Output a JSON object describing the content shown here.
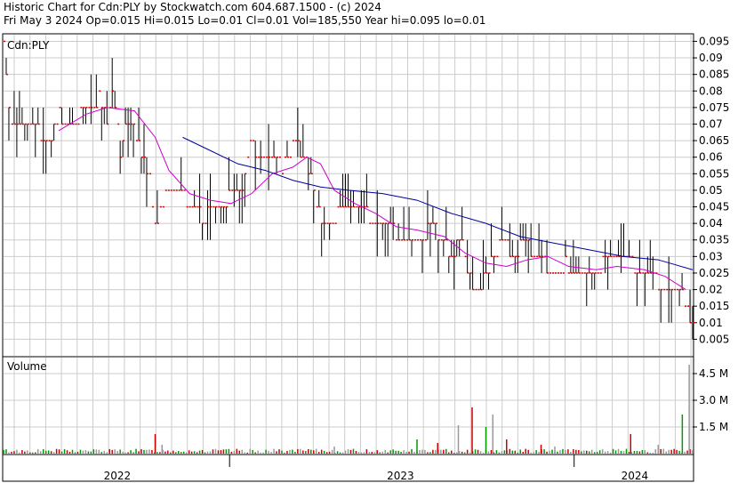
{
  "header": {
    "line1": "Historic Chart for Cdn:PLY by Stockwatch.com 604.687.1500 - (c) 2024",
    "line2": "Fri May  3 2024   Op=0.015   Hi=0.015   Lo=0.01   Cl=0.01   Vol=185,550   Year hi=0.095   lo=0.01"
  },
  "chart_data": {
    "type": "ohlc",
    "title": "Cdn:PLY",
    "price_axis": {
      "ticks": [
        "0.095",
        "0.09",
        "0.085",
        "0.08",
        "0.075",
        "0.07",
        "0.065",
        "0.06",
        "0.055",
        "0.05",
        "0.045",
        "0.04",
        "0.035",
        "0.03",
        "0.025",
        "0.02",
        "0.015",
        "0.01",
        "0.005"
      ],
      "ylim": [
        0.0,
        0.097
      ]
    },
    "volume_axis": {
      "label": "Volume",
      "ticks": [
        "4.5 M",
        "3.0 M",
        "1.5 M"
      ],
      "ylim": [
        0,
        5.4
      ]
    },
    "x_axis": {
      "labels": [
        "2022",
        "2023",
        "2024"
      ]
    },
    "series": [
      {
        "name": "price",
        "color": "#000000",
        "close_marker_color": "#cc0000"
      },
      {
        "name": "short moving average",
        "color": "#cc00cc"
      },
      {
        "name": "long moving average",
        "color": "#000099"
      }
    ],
    "price_points": [
      {
        "t": 0.0,
        "c": 0.095
      },
      {
        "t": 0.01,
        "c": 0.07
      },
      {
        "t": 0.025,
        "c": 0.068
      },
      {
        "t": 0.045,
        "c": 0.072
      },
      {
        "t": 0.06,
        "c": 0.062
      },
      {
        "t": 0.08,
        "c": 0.073
      },
      {
        "t": 0.1,
        "c": 0.07
      },
      {
        "t": 0.12,
        "c": 0.075
      },
      {
        "t": 0.14,
        "c": 0.078
      },
      {
        "t": 0.15,
        "c": 0.07
      },
      {
        "t": 0.16,
        "c": 0.08
      },
      {
        "t": 0.17,
        "c": 0.06
      },
      {
        "t": 0.18,
        "c": 0.072
      },
      {
        "t": 0.195,
        "c": 0.065
      },
      {
        "t": 0.21,
        "c": 0.055
      },
      {
        "t": 0.22,
        "c": 0.04
      },
      {
        "t": 0.235,
        "c": 0.05
      },
      {
        "t": 0.255,
        "c": 0.052
      },
      {
        "t": 0.27,
        "c": 0.045
      },
      {
        "t": 0.29,
        "c": 0.042
      },
      {
        "t": 0.31,
        "c": 0.045
      },
      {
        "t": 0.33,
        "c": 0.048
      },
      {
        "t": 0.345,
        "c": 0.05
      },
      {
        "t": 0.36,
        "c": 0.065
      },
      {
        "t": 0.375,
        "c": 0.058
      },
      {
        "t": 0.39,
        "c": 0.062
      },
      {
        "t": 0.405,
        "c": 0.056
      },
      {
        "t": 0.42,
        "c": 0.065
      },
      {
        "t": 0.435,
        "c": 0.06
      },
      {
        "t": 0.45,
        "c": 0.05
      },
      {
        "t": 0.465,
        "c": 0.04
      },
      {
        "t": 0.48,
        "c": 0.042
      },
      {
        "t": 0.5,
        "c": 0.045
      },
      {
        "t": 0.515,
        "c": 0.045
      },
      {
        "t": 0.53,
        "c": 0.042
      },
      {
        "t": 0.545,
        "c": 0.038
      },
      {
        "t": 0.56,
        "c": 0.04
      },
      {
        "t": 0.575,
        "c": 0.035
      },
      {
        "t": 0.59,
        "c": 0.033
      },
      {
        "t": 0.605,
        "c": 0.035
      },
      {
        "t": 0.62,
        "c": 0.04
      },
      {
        "t": 0.635,
        "c": 0.035
      },
      {
        "t": 0.65,
        "c": 0.03
      },
      {
        "t": 0.665,
        "c": 0.035
      },
      {
        "t": 0.68,
        "c": 0.02
      },
      {
        "t": 0.695,
        "c": 0.022
      },
      {
        "t": 0.71,
        "c": 0.03
      },
      {
        "t": 0.725,
        "c": 0.035
      },
      {
        "t": 0.74,
        "c": 0.03
      },
      {
        "t": 0.755,
        "c": 0.035
      },
      {
        "t": 0.77,
        "c": 0.03
      },
      {
        "t": 0.785,
        "c": 0.028
      },
      {
        "t": 0.8,
        "c": 0.025
      },
      {
        "t": 0.815,
        "c": 0.028
      },
      {
        "t": 0.83,
        "c": 0.025
      },
      {
        "t": 0.845,
        "c": 0.025
      },
      {
        "t": 0.86,
        "c": 0.025
      },
      {
        "t": 0.875,
        "c": 0.03
      },
      {
        "t": 0.89,
        "c": 0.028
      },
      {
        "t": 0.905,
        "c": 0.03
      },
      {
        "t": 0.92,
        "c": 0.025
      },
      {
        "t": 0.935,
        "c": 0.025
      },
      {
        "t": 0.95,
        "c": 0.022
      },
      {
        "t": 0.965,
        "c": 0.02
      },
      {
        "t": 0.98,
        "c": 0.02
      },
      {
        "t": 0.99,
        "c": 0.015
      },
      {
        "t": 1.0,
        "c": 0.01
      }
    ],
    "short_ma": [
      {
        "t": 0.08,
        "v": 0.068
      },
      {
        "t": 0.12,
        "v": 0.073
      },
      {
        "t": 0.15,
        "v": 0.075
      },
      {
        "t": 0.19,
        "v": 0.074
      },
      {
        "t": 0.22,
        "v": 0.066
      },
      {
        "t": 0.24,
        "v": 0.056
      },
      {
        "t": 0.27,
        "v": 0.049
      },
      {
        "t": 0.3,
        "v": 0.047
      },
      {
        "t": 0.33,
        "v": 0.046
      },
      {
        "t": 0.36,
        "v": 0.049
      },
      {
        "t": 0.39,
        "v": 0.055
      },
      {
        "t": 0.42,
        "v": 0.057
      },
      {
        "t": 0.44,
        "v": 0.06
      },
      {
        "t": 0.46,
        "v": 0.058
      },
      {
        "t": 0.48,
        "v": 0.05
      },
      {
        "t": 0.51,
        "v": 0.046
      },
      {
        "t": 0.54,
        "v": 0.043
      },
      {
        "t": 0.57,
        "v": 0.039
      },
      {
        "t": 0.6,
        "v": 0.038
      },
      {
        "t": 0.64,
        "v": 0.036
      },
      {
        "t": 0.67,
        "v": 0.031
      },
      {
        "t": 0.7,
        "v": 0.028
      },
      {
        "t": 0.73,
        "v": 0.027
      },
      {
        "t": 0.76,
        "v": 0.029
      },
      {
        "t": 0.79,
        "v": 0.03
      },
      {
        "t": 0.82,
        "v": 0.027
      },
      {
        "t": 0.86,
        "v": 0.026
      },
      {
        "t": 0.89,
        "v": 0.027
      },
      {
        "t": 0.93,
        "v": 0.026
      },
      {
        "t": 0.96,
        "v": 0.024
      },
      {
        "t": 0.99,
        "v": 0.02
      }
    ],
    "long_ma": [
      {
        "t": 0.26,
        "v": 0.066
      },
      {
        "t": 0.3,
        "v": 0.062
      },
      {
        "t": 0.34,
        "v": 0.058
      },
      {
        "t": 0.38,
        "v": 0.056
      },
      {
        "t": 0.42,
        "v": 0.053
      },
      {
        "t": 0.46,
        "v": 0.051
      },
      {
        "t": 0.5,
        "v": 0.05
      },
      {
        "t": 0.55,
        "v": 0.049
      },
      {
        "t": 0.6,
        "v": 0.047
      },
      {
        "t": 0.65,
        "v": 0.043
      },
      {
        "t": 0.7,
        "v": 0.04
      },
      {
        "t": 0.75,
        "v": 0.036
      },
      {
        "t": 0.8,
        "v": 0.034
      },
      {
        "t": 0.85,
        "v": 0.032
      },
      {
        "t": 0.9,
        "v": 0.03
      },
      {
        "t": 0.95,
        "v": 0.029
      },
      {
        "t": 1.0,
        "v": 0.026
      }
    ],
    "volume_spikes": [
      {
        "t": 0.22,
        "v": 1.1,
        "color": "#cc0000"
      },
      {
        "t": 0.23,
        "v": 0.5,
        "color": "#999999"
      },
      {
        "t": 0.48,
        "v": 0.4,
        "color": "#999999"
      },
      {
        "t": 0.6,
        "v": 0.8,
        "color": "#009900"
      },
      {
        "t": 0.63,
        "v": 0.6,
        "color": "#cc0000"
      },
      {
        "t": 0.66,
        "v": 1.6,
        "color": "#999999"
      },
      {
        "t": 0.68,
        "v": 2.6,
        "color": "#cc0000"
      },
      {
        "t": 0.7,
        "v": 1.5,
        "color": "#009900"
      },
      {
        "t": 0.71,
        "v": 2.2,
        "color": "#999999"
      },
      {
        "t": 0.73,
        "v": 0.8,
        "color": "#cc0000"
      },
      {
        "t": 0.78,
        "v": 0.5,
        "color": "#cc0000"
      },
      {
        "t": 0.8,
        "v": 0.4,
        "color": "#999999"
      },
      {
        "t": 0.91,
        "v": 1.1,
        "color": "#cc0000"
      },
      {
        "t": 0.95,
        "v": 0.5,
        "color": "#999999"
      },
      {
        "t": 0.995,
        "v": 5.0,
        "color": "#999999"
      },
      {
        "t": 0.985,
        "v": 2.2,
        "color": "#009900"
      }
    ]
  }
}
